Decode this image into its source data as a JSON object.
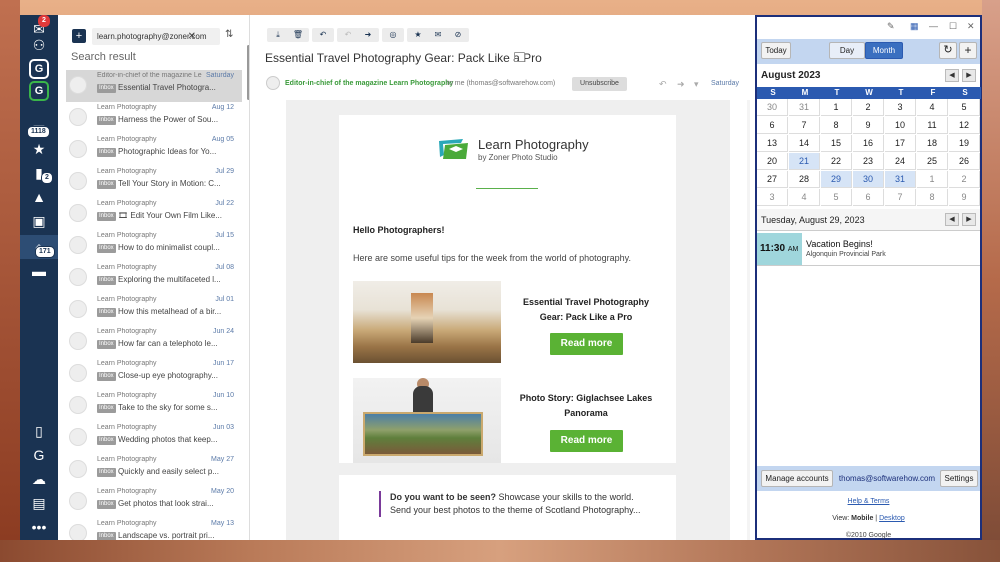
{
  "rail": {
    "badge_top": "2",
    "badges": [
      "1118",
      "2",
      "171"
    ]
  },
  "list": {
    "search_value": "learn.photography@zoner.com",
    "search_title": "Search result",
    "tag": "Inbox",
    "messages": [
      {
        "from": "Editor-in-chief of the magazine Le",
        "date": "Saturday",
        "subject": "Essential Travel Photogra..."
      },
      {
        "from": "Learn Photography",
        "date": "Aug 12",
        "subject": "Harness the Power of Sou..."
      },
      {
        "from": "Learn Photography",
        "date": "Aug 05",
        "subject": "Photographic Ideas for Yo..."
      },
      {
        "from": "Learn Photography",
        "date": "Jul 29",
        "subject": "Tell Your Story in Motion: C..."
      },
      {
        "from": "Learn Photography",
        "date": "Jul 22",
        "subject": "🎞 Edit Your Own Film Like..."
      },
      {
        "from": "Learn Photography",
        "date": "Jul 15",
        "subject": "How to do minimalist coupl..."
      },
      {
        "from": "Learn Photography",
        "date": "Jul 08",
        "subject": "Exploring the multifaceted l..."
      },
      {
        "from": "Learn Photography",
        "date": "Jul 01",
        "subject": "How this metalhead of a bir..."
      },
      {
        "from": "Learn Photography",
        "date": "Jun 24",
        "subject": "How far can a telephoto le..."
      },
      {
        "from": "Learn Photography",
        "date": "Jun 17",
        "subject": "Close-up eye photography..."
      },
      {
        "from": "Learn Photography",
        "date": "Jun 10",
        "subject": "Take to the sky for some s..."
      },
      {
        "from": "Learn Photography",
        "date": "Jun 03",
        "subject": "Wedding photos that keep..."
      },
      {
        "from": "Learn Photography",
        "date": "May 27",
        "subject": "Quickly and easily select p..."
      },
      {
        "from": "Learn Photography",
        "date": "May 20",
        "subject": "Get photos that look strai..."
      },
      {
        "from": "Learn Photography",
        "date": "May 13",
        "subject": "Landscape vs. portrait pri..."
      }
    ]
  },
  "reader": {
    "subject": "Essential Travel Photography Gear: Pack Like a Pro",
    "sender": "Editor-in-chief of the magazine Learn Photography",
    "to": "to me (thomas@softwarehow.com)",
    "unsubscribe": "Unsubscribe",
    "date": "Saturday",
    "logo_title": "Learn Photography",
    "logo_sub": "by Zoner Photo Studio",
    "hello": "Hello Photographers!",
    "intro": "Here are some useful tips for the week from the world of photography.",
    "article1": "Essential Travel Photography Gear: Pack Like a Pro",
    "article2": "Photo Story: Giglachsee Lakes Panorama",
    "read_more": "Read more",
    "quote_bold": "Do you want to be seen?",
    "quote_rest": " Showcase your skills to the world. Send your best photos to the theme of Scotland Photography..."
  },
  "calendar": {
    "today": "Today",
    "day": "Day",
    "month": "Month",
    "month_label": "August 2023",
    "dow": [
      "S",
      "M",
      "T",
      "W",
      "T",
      "F",
      "S"
    ],
    "weeks": [
      [
        "30",
        "31",
        "1",
        "2",
        "3",
        "4",
        "5"
      ],
      [
        "6",
        "7",
        "8",
        "9",
        "10",
        "11",
        "12"
      ],
      [
        "13",
        "14",
        "15",
        "16",
        "17",
        "18",
        "19"
      ],
      [
        "20",
        "21",
        "22",
        "23",
        "24",
        "25",
        "26"
      ],
      [
        "27",
        "28",
        "29",
        "30",
        "31",
        "1",
        "2"
      ],
      [
        "3",
        "4",
        "5",
        "6",
        "7",
        "8",
        "9"
      ]
    ],
    "day_label": "Tuesday, August 29, 2023",
    "event_time": "11:30",
    "event_ampm": "AM",
    "event_title": "Vacation Begins!",
    "event_location": "Algonquin Provincial Park",
    "manage": "Manage accounts",
    "account": "thomas@softwarehow.com",
    "settings": "Settings",
    "help": "Help & Terms",
    "view_prefix": "View: ",
    "view_mobile": "Mobile",
    "view_sep": " | ",
    "view_desktop": "Desktop",
    "copyright": "©2010 Google"
  }
}
